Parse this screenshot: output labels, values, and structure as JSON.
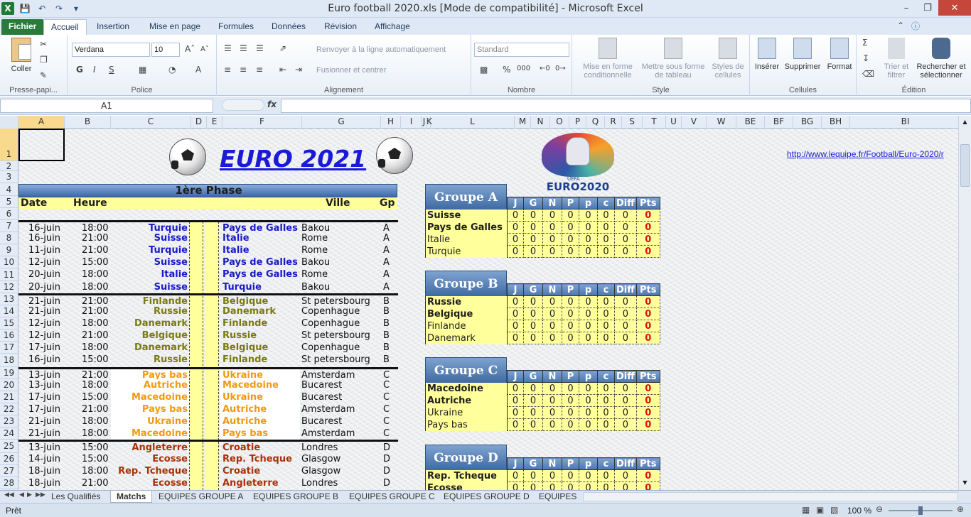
{
  "window": {
    "title": "Euro football 2020.xls  [Mode de compatibilité]  -  Microsoft Excel"
  },
  "ribbon": {
    "tabs": [
      "Fichier",
      "Accueil",
      "Insertion",
      "Mise en page",
      "Formules",
      "Données",
      "Révision",
      "Affichage"
    ],
    "active_tab": "Accueil",
    "clipboard": {
      "paste": "Coller",
      "label": "Presse-papi..."
    },
    "font": {
      "name": "Verdana",
      "size": "10",
      "label": "Police",
      "bold": "G",
      "italic": "I",
      "underline": "S"
    },
    "alignment": {
      "wrap": "Renvoyer à la ligne automatiquement",
      "merge": "Fusionner et centrer",
      "label": "Alignement"
    },
    "number": {
      "format": "Standard",
      "label": "Nombre",
      "percent": "%",
      "thousands": "000"
    },
    "style": {
      "cond": "Mise en forme conditionnelle",
      "table": "Mettre sous forme de tableau",
      "cells": "Styles de cellules",
      "label": "Style"
    },
    "cells": {
      "insert": "Insérer",
      "delete": "Supprimer",
      "format": "Format",
      "label": "Cellules"
    },
    "editing": {
      "sort": "Trier et filtrer",
      "find": "Rechercher et sélectionner",
      "label": "Édition"
    }
  },
  "formula_bar": {
    "name_box": "A1",
    "fx": "fx",
    "formula": ""
  },
  "columns": [
    "A",
    "B",
    "C",
    "D",
    "E",
    "F",
    "G",
    "H",
    "I",
    "J",
    "K",
    "L",
    "M",
    "N",
    "O",
    "P",
    "Q",
    "R",
    "S",
    "T",
    "U",
    "V",
    "W",
    "BE",
    "BF",
    "BG",
    "BH",
    "BI"
  ],
  "rows": [
    "1",
    "2",
    "3",
    "4",
    "5",
    "6",
    "7",
    "8",
    "9",
    "10",
    "11",
    "12",
    "13",
    "14",
    "15",
    "16",
    "17",
    "18",
    "19",
    "20",
    "21",
    "22",
    "23",
    "24",
    "25",
    "26",
    "27",
    "28"
  ],
  "sheet": {
    "title": "EURO 2021",
    "link": "http://www.lequipe.fr/Football/Euro-2020/r",
    "phase": "1ère Phase",
    "headers": {
      "date": "Date",
      "heure": "Heure",
      "ville": "Ville",
      "gp": "Gp"
    },
    "logo_text": "EURO2020",
    "logo_sub": "UEFA",
    "matches": [
      {
        "date": "16-juin",
        "heure": "18:00",
        "home": "Turquie",
        "away": "Pays de Galles",
        "ville": "Bakou",
        "gp": "A",
        "color": "#1a1ac8"
      },
      {
        "date": "16-juin",
        "heure": "21:00",
        "home": "Suisse",
        "away": "Italie",
        "ville": "Rome",
        "gp": "A",
        "color": "#1a1ac8"
      },
      {
        "date": "11-juin",
        "heure": "21:00",
        "home": "Turquie",
        "away": "Italie",
        "ville": "Rome",
        "gp": "A",
        "color": "#1a1ac8"
      },
      {
        "date": "12-juin",
        "heure": "15:00",
        "home": "Suisse",
        "away": "Pays de Galles",
        "ville": "Bakou",
        "gp": "A",
        "color": "#1a1ac8"
      },
      {
        "date": "20-juin",
        "heure": "18:00",
        "home": "Italie",
        "away": "Pays de Galles",
        "ville": "Rome",
        "gp": "A",
        "color": "#1a1ac8"
      },
      {
        "date": "20-juin",
        "heure": "18:00",
        "home": "Suisse",
        "away": "Turquie",
        "ville": "Bakou",
        "gp": "A",
        "color": "#1a1ac8"
      },
      {
        "date": "21-juin",
        "heure": "21:00",
        "home": "Finlande",
        "away": "Belgique",
        "ville": "St petersbourg",
        "gp": "B",
        "color": "#7a7a10"
      },
      {
        "date": "21-juin",
        "heure": "21:00",
        "home": "Russie",
        "away": "Danemark",
        "ville": "Copenhague",
        "gp": "B",
        "color": "#7a7a10"
      },
      {
        "date": "12-juin",
        "heure": "18:00",
        "home": "Danemark",
        "away": "Finlande",
        "ville": "Copenhague",
        "gp": "B",
        "color": "#7a7a10"
      },
      {
        "date": "12-juin",
        "heure": "21:00",
        "home": "Belgique",
        "away": "Russie",
        "ville": "St petersbourg",
        "gp": "B",
        "color": "#7a7a10"
      },
      {
        "date": "17-juin",
        "heure": "18:00",
        "home": "Danemark",
        "away": "Belgique",
        "ville": "Copenhague",
        "gp": "B",
        "color": "#7a7a10"
      },
      {
        "date": "16-juin",
        "heure": "15:00",
        "home": "Russie",
        "away": "Finlande",
        "ville": "St petersbourg",
        "gp": "B",
        "color": "#7a7a10"
      },
      {
        "date": "13-juin",
        "heure": "21:00",
        "home": "Pays bas",
        "away": "Ukraine",
        "ville": "Amsterdam",
        "gp": "C",
        "color": "#f09a10"
      },
      {
        "date": "13-juin",
        "heure": "18:00",
        "home": "Autriche",
        "away": "Macedoine",
        "ville": "Bucarest",
        "gp": "C",
        "color": "#f09a10"
      },
      {
        "date": "17-juin",
        "heure": "15:00",
        "home": "Macedoine",
        "away": "Ukraine",
        "ville": "Bucarest",
        "gp": "C",
        "color": "#f09a10"
      },
      {
        "date": "17-juin",
        "heure": "21:00",
        "home": "Pays bas",
        "away": "Autriche",
        "ville": "Amsterdam",
        "gp": "C",
        "color": "#f09a10"
      },
      {
        "date": "21-juin",
        "heure": "18:00",
        "home": "Ukraine",
        "away": "Autriche",
        "ville": "Bucarest",
        "gp": "C",
        "color": "#f09a10"
      },
      {
        "date": "21-juin",
        "heure": "18:00",
        "home": "Macedoine",
        "away": "Pays bas",
        "ville": "Amsterdam",
        "gp": "C",
        "color": "#f09a10"
      },
      {
        "date": "13-juin",
        "heure": "15:00",
        "home": "Angleterre",
        "away": "Croatie",
        "ville": "Londres",
        "gp": "D",
        "color": "#a83208"
      },
      {
        "date": "14-juin",
        "heure": "15:00",
        "home": "Ecosse",
        "away": "Rep. Tcheque",
        "ville": "Glasgow",
        "gp": "D",
        "color": "#a83208"
      },
      {
        "date": "18-juin",
        "heure": "18:00",
        "home": "Rep. Tcheque",
        "away": "Croatie",
        "ville": "Glasgow",
        "gp": "D",
        "color": "#a83208"
      },
      {
        "date": "18-juin",
        "heure": "21:00",
        "home": "Ecosse",
        "away": "Angleterre",
        "ville": "Londres",
        "gp": "D",
        "color": "#a83208"
      }
    ],
    "stat_headers": [
      "J",
      "G",
      "N",
      "P",
      "p",
      "c",
      "Diff",
      "Pts"
    ],
    "groups": [
      {
        "name": "Groupe A",
        "teams": [
          {
            "n": "Suisse",
            "b": true
          },
          {
            "n": "Pays de Galles",
            "b": true
          },
          {
            "n": "Italie",
            "b": false
          },
          {
            "n": "Turquie",
            "b": false
          }
        ]
      },
      {
        "name": "Groupe B",
        "teams": [
          {
            "n": "Russie",
            "b": true
          },
          {
            "n": "Belgique",
            "b": true
          },
          {
            "n": "Finlande",
            "b": false
          },
          {
            "n": "Danemark",
            "b": false
          }
        ]
      },
      {
        "name": "Groupe C",
        "teams": [
          {
            "n": "Macedoine",
            "b": true
          },
          {
            "n": "Autriche",
            "b": true
          },
          {
            "n": "Ukraine",
            "b": false
          },
          {
            "n": "Pays bas",
            "b": false
          }
        ]
      },
      {
        "name": "Groupe D",
        "teams": [
          {
            "n": "Rep. Tcheque",
            "b": true
          },
          {
            "n": "Ecosse",
            "b": true
          }
        ]
      }
    ],
    "stat_values": [
      "0",
      "0",
      "0",
      "0",
      "0",
      "0",
      "0",
      "0"
    ]
  },
  "sheet_tabs": [
    "Les Qualifiés",
    "Matchs",
    "EQUIPES GROUPE A",
    "EQUIPES GROUPE B",
    "EQUIPES GROUPE C",
    "EQUIPES GROUPE D",
    "EQUIPES"
  ],
  "active_sheet": "Matchs",
  "status": {
    "ready": "Prêt",
    "zoom": "100 %"
  }
}
